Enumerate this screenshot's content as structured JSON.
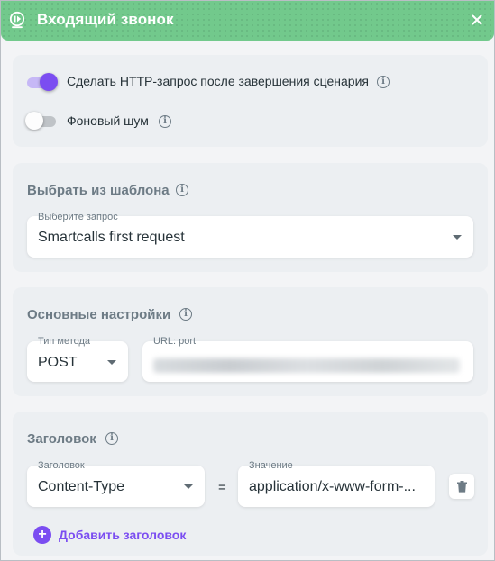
{
  "header": {
    "title": "Входящий звонок",
    "icon": "phone-play-icon",
    "close_icon": "close-icon",
    "color": "#72c98c"
  },
  "toggles": {
    "http_request": {
      "label": "Сделать HTTP-запрос после завершения сценария",
      "enabled": true
    },
    "background_noise": {
      "label": "Фоновый шум",
      "enabled": false
    }
  },
  "template": {
    "title": "Выбрать из шаблона",
    "select_label": "Выберите запрос",
    "select_value": "Smartcalls first request"
  },
  "basic": {
    "title": "Основные настройки",
    "method_label": "Тип метода",
    "method_value": "POST",
    "url_label": "URL: port"
  },
  "headers": {
    "title": "Заголовок",
    "name_label": "Заголовок",
    "name_value": "Content-Type",
    "equals": "=",
    "value_label": "Значение",
    "value_value": "application/x-www-form-...",
    "delete_icon": "trash-icon",
    "add_label": "Добавить заголовок"
  },
  "accent": "#7b4df1"
}
